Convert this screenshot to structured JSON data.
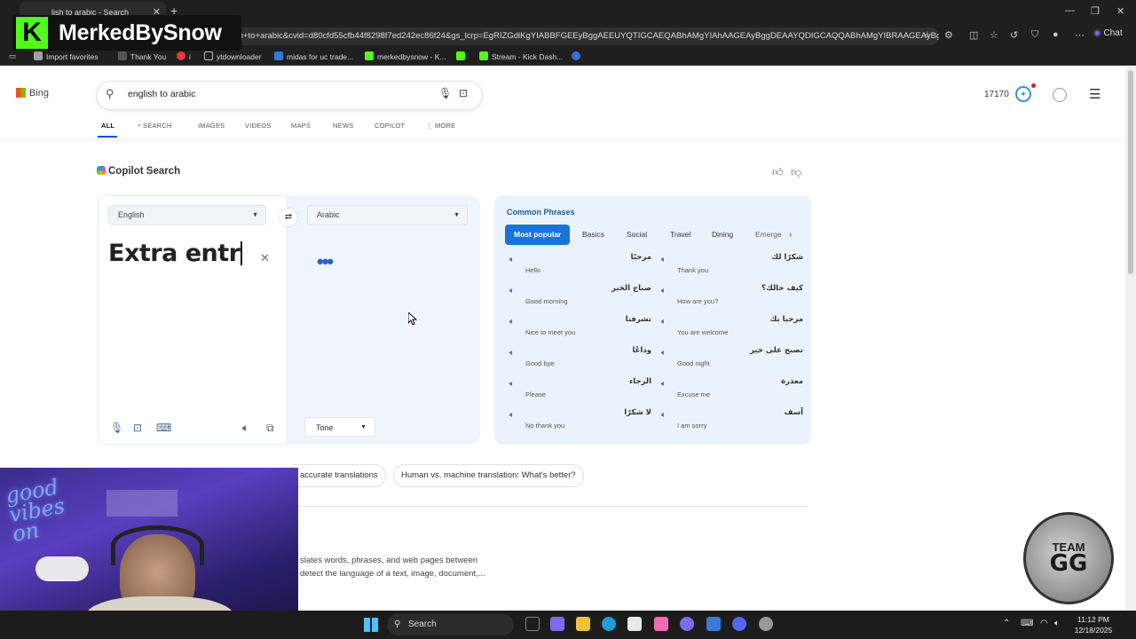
{
  "browser": {
    "tab_title": "lish to arabic - Search",
    "tab_close": "✕",
    "new_tab": "+",
    "window_controls": [
      "—",
      "❐",
      "✕"
    ],
    "address": "sh+to+arabic&cvid=d80cfd55cfb44f8298f7ed242ec86f24&gs_lcrp=EgRIZGdlKgYIABBFGEEyBggAEEUYQTIGCAEQABhAMgYIAhAAGEAyBggDEAAYQDIGCAQQABhAMgYIBRAAGEAyBgg...",
    "chat_label": "Chat",
    "favorites": [
      {
        "label": "Import favorites",
        "color": "#9aa0a6"
      },
      {
        "label": "Thank You",
        "color": "#555555"
      },
      {
        "label": "i",
        "color": "#e53935"
      },
      {
        "label": "ytdownloader",
        "color": "#888888"
      },
      {
        "label": "midas for uc trade...",
        "color": "#2e7bd6"
      },
      {
        "label": "merkedbysnow - K...",
        "color": "#53fc18"
      },
      {
        "label": "",
        "color": "#53fc18"
      },
      {
        "label": "Stream - Kick Dash...",
        "color": "#53fc18"
      },
      {
        "label": "",
        "color": "#3b6fd6"
      }
    ]
  },
  "overlay": {
    "brand_letter": "K",
    "brand_name": "MerkedBySnow"
  },
  "bing": {
    "logo_text": "Bing",
    "query": "english to arabic",
    "points": "17170",
    "nav_tabs": [
      "ALL",
      "SEARCH",
      "IMAGES",
      "VIDEOS",
      "MAPS",
      "NEWS",
      "COPILOT",
      "MORE"
    ],
    "active_tab": "ALL",
    "copilot_title": "Copilot Search"
  },
  "translator": {
    "source_lang": "English",
    "target_lang": "Arabic",
    "source_text": "Extra entr",
    "typing_indicator": "•••",
    "tone_label": "Tone"
  },
  "phrases": {
    "title": "Common Phrases",
    "tabs": [
      "Most popular",
      "Basics",
      "Social",
      "Travel",
      "Dining",
      "Emerge"
    ],
    "active_tab": "Most popular",
    "items": [
      {
        "ar": "مرحبًا",
        "en": "Hello"
      },
      {
        "ar": "شكرًا لك",
        "en": "Thank you"
      },
      {
        "ar": "صباح الخير",
        "en": "Good morning"
      },
      {
        "ar": "كيف حالك؟",
        "en": "How are you?"
      },
      {
        "ar": "تشرفنا",
        "en": "Nice to meet you"
      },
      {
        "ar": "مرحبا بك",
        "en": "You are welcome"
      },
      {
        "ar": "وداعًا",
        "en": "Good bye"
      },
      {
        "ar": "تصبح على خير",
        "en": "Good night"
      },
      {
        "ar": "الرجاء",
        "en": "Please"
      },
      {
        "ar": "معذرة",
        "en": "Excuse me"
      },
      {
        "ar": "لا شكرًا",
        "en": "No thank you"
      },
      {
        "ar": "آسف",
        "en": "I am sorry"
      }
    ]
  },
  "related": {
    "pills": [
      "accurate translations",
      "Human vs. machine translation: What's better?"
    ],
    "desc_lines": [
      "slates words, phrases, and web pages between",
      "detect the language of a text, image, document,..."
    ]
  },
  "webcam": {
    "neon_text": "good vibes on"
  },
  "badge": {
    "line1": "TEAM",
    "line2": "GG"
  },
  "taskbar": {
    "search_label": "Search",
    "time": "11:12 PM",
    "date": "12/18/2025",
    "apps": [
      {
        "name": "file-explorer-icon",
        "color": "#f3c13a"
      },
      {
        "name": "edge-icon",
        "color": "#1f9bd6"
      },
      {
        "name": "store-icon",
        "color": "#e9e9e9"
      },
      {
        "name": "paint-icon",
        "color": "#f06bb6"
      },
      {
        "name": "copilot-icon",
        "color": "#7b6cf0"
      },
      {
        "name": "app-icon",
        "color": "#3a7bd5"
      },
      {
        "name": "discord-icon",
        "color": "#5865f2"
      },
      {
        "name": "app2-icon",
        "color": "#999999"
      }
    ]
  }
}
